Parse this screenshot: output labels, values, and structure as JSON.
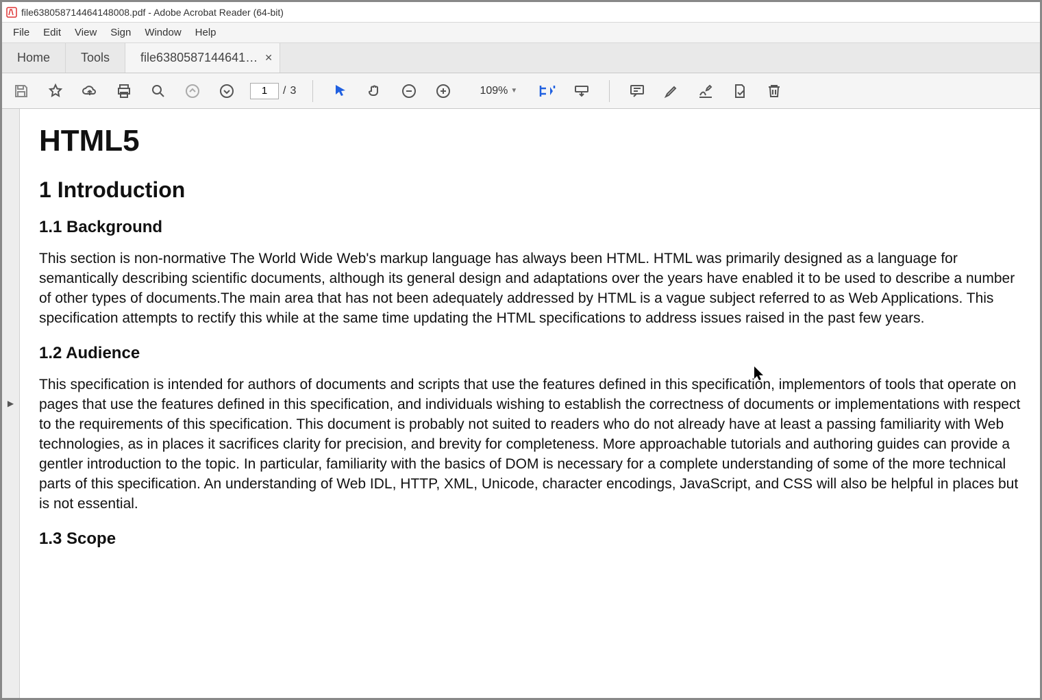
{
  "window": {
    "title": "file638058714464148008.pdf - Adobe Acrobat Reader (64-bit)"
  },
  "menubar": [
    "File",
    "Edit",
    "View",
    "Sign",
    "Window",
    "Help"
  ],
  "tabs": {
    "home": "Home",
    "tools": "Tools",
    "doc": "file6380587144641…"
  },
  "toolbar": {
    "page_current": "1",
    "page_sep": "/",
    "page_total": "3",
    "zoom": "109%"
  },
  "document": {
    "h1": "HTML5",
    "h2_intro": "1 Introduction",
    "h3_background": "1.1 Background",
    "p_background": "This section is non-normative The World Wide Web's markup language has always been HTML. HTML was primarily designed as a language for semantically describing scientific documents, although its general design and adaptations over the years have enabled it to be used to describe a number of other types of documents.The main area that has not been adequately addressed by HTML is a vague subject referred to as Web Applications. This specification attempts to rectify this while at the same time updating the HTML specifications to address issues raised in the past few years.",
    "h3_audience": "1.2 Audience",
    "p_audience": "This specification is intended for authors of documents and scripts that use the features defined in this specification, implementors of tools that operate on pages that use the features defined in this specification, and individuals wishing to establish the correctness of documents or implementations with respect to the requirements of this specification. This document is probably not suited to readers who do not already have at least a passing familiarity with Web technologies, as in places it sacrifices clarity for precision, and brevity for completeness. More approachable tutorials and authoring guides can provide a gentler introduction to the topic. In particular, familiarity with the basics of DOM is necessary for a complete understanding of some of the more technical parts of this specification. An understanding of Web IDL, HTTP, XML, Unicode, character encodings, JavaScript, and CSS will also be helpful in places but is not essential.",
    "h3_scope": "1.3 Scope"
  }
}
